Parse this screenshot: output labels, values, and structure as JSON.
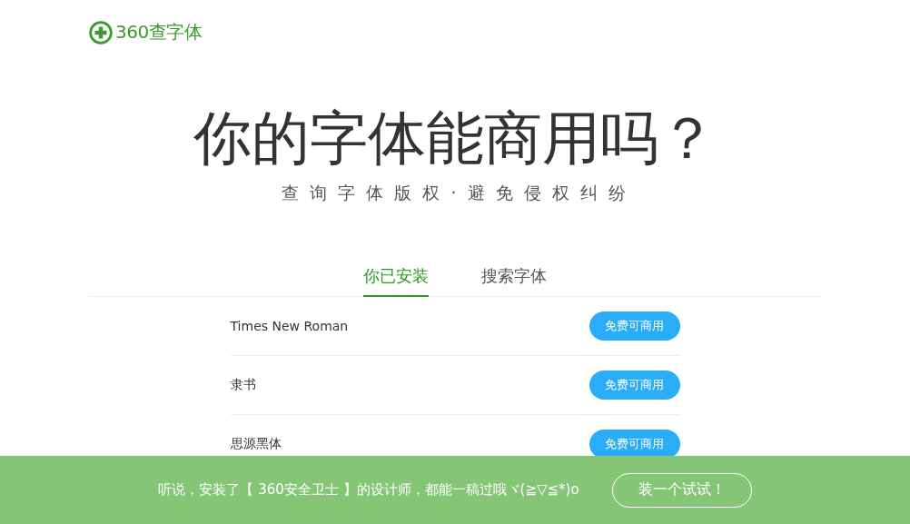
{
  "logo": {
    "text": "360查字体"
  },
  "headline": "你的字体能商用吗？",
  "subtitle": "查 询 字 体 版 权 · 避 免 侵 权 纠 纷",
  "tabs": [
    {
      "label": "你已安装",
      "selected": true
    },
    {
      "label": "搜索字体",
      "selected": false
    }
  ],
  "fonts": [
    {
      "name": "Times New Roman",
      "license": "免费可商用"
    },
    {
      "name": "隶书",
      "license": "免费可商用"
    },
    {
      "name": "思源黑体",
      "license": "免费可商用"
    }
  ],
  "banner": {
    "text": "听说，安装了【 360安全卫士 】的设计师，都能一稿过哦ヾ(≧▽≦*)o",
    "button": "装一个试试！"
  }
}
